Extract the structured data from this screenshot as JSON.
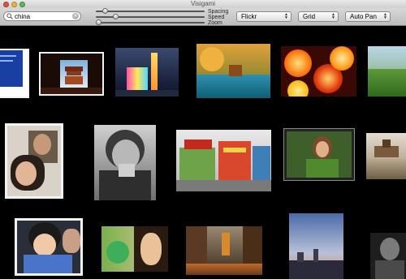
{
  "window": {
    "title": "Visigami"
  },
  "search": {
    "value": "china",
    "icon": "magnifier-icon",
    "clear_icon": "clear-icon"
  },
  "sliders": [
    {
      "label": "Spacing",
      "value": 0.08
    },
    {
      "label": "Speed",
      "value": 0.17
    },
    {
      "label": "Zoom",
      "value": 0.02
    }
  ],
  "toolbar": {
    "source": "Flickr",
    "layout": "Grid",
    "pan": "Auto Pan"
  },
  "photos": [
    {
      "subject": "blue screen"
    },
    {
      "subject": "pagoda through doorway"
    },
    {
      "subject": "illuminated tower at night"
    },
    {
      "subject": "autumn lake"
    },
    {
      "subject": "red paper umbrellas"
    },
    {
      "subject": "green terraced hills"
    },
    {
      "subject": "woman portrait with frame"
    },
    {
      "subject": "black and white girl"
    },
    {
      "subject": "colorful street buildings"
    },
    {
      "subject": "woman in green"
    },
    {
      "subject": "great wall"
    },
    {
      "subject": "child portrait"
    },
    {
      "subject": "woman with green blur"
    },
    {
      "subject": "street at night"
    },
    {
      "subject": "city skyline at dusk"
    },
    {
      "subject": "man portrait"
    }
  ]
}
